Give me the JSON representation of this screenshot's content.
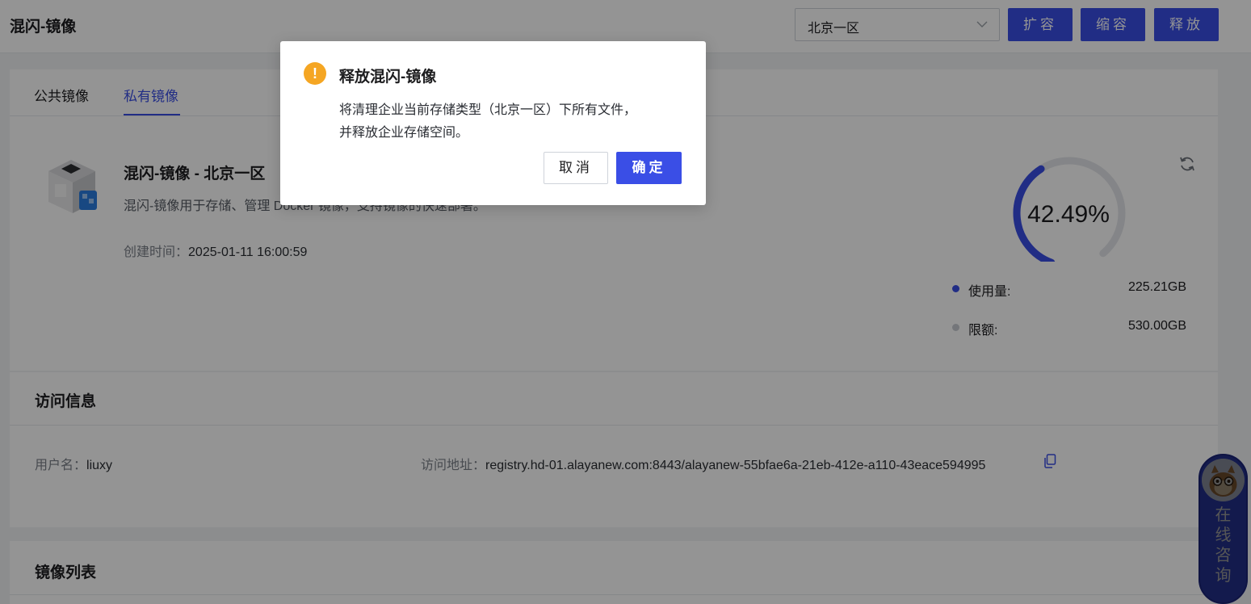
{
  "header": {
    "title": "混闪-镜像",
    "region_value": "北京一区",
    "btn_expand": "扩容",
    "btn_shrink": "缩容",
    "btn_release": "释放"
  },
  "tabs": [
    {
      "label": "公共镜像",
      "active": false
    },
    {
      "label": "私有镜像",
      "active": true
    }
  ],
  "product": {
    "name": "混闪-镜像 - 北京一区",
    "description": "混闪-镜像用于存储、管理 Docker 镜像，支持镜像的快速部署。",
    "created_label": "创建时间：",
    "created_value": "2025-01-11 16:00:59"
  },
  "usage": {
    "percent_text": "42.49%",
    "percent": 42.49,
    "used_label": "使用量:",
    "used_value": "225.21GB",
    "quota_label": "限额:",
    "quota_value": "530.00GB",
    "used_color": "#3a4ee6",
    "quota_color": "#c8ccd3"
  },
  "access": {
    "title": "访问信息",
    "username_label": "用户名：",
    "username_value": "liuxy",
    "address_label": "访问地址：",
    "address_value": "registry.hd-01.alayanew.com:8443/alayanew-55bfae6a-21eb-412e-a110-43eace594995"
  },
  "image_list": {
    "title": "镜像列表"
  },
  "dialog": {
    "title": "释放混闪-镜像",
    "line1": "将清理企业当前存储类型（北京一区）下所有文件，",
    "line2": "并释放企业存储空间。",
    "cancel": "取消",
    "ok": "确定",
    "warn_glyph": "!"
  },
  "consult": {
    "text_1": "在",
    "text_2": "线",
    "text_3": "咨",
    "text_4": "询"
  },
  "colors": {
    "primary": "#3a4ee6",
    "warning": "#f5a623"
  }
}
